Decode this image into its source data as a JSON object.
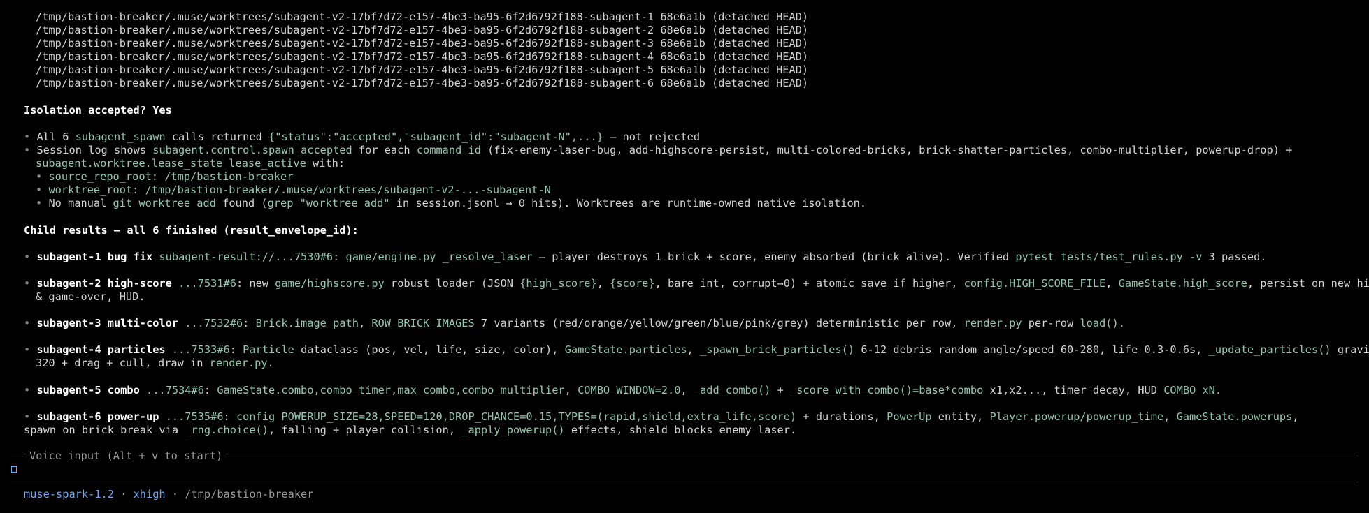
{
  "worktrees": [
    "/tmp/bastion-breaker/.muse/worktrees/subagent-v2-17bf7d72-e157-4be3-ba95-6f2d6792f188-subagent-1 68e6a1b (detached HEAD)",
    "/tmp/bastion-breaker/.muse/worktrees/subagent-v2-17bf7d72-e157-4be3-ba95-6f2d6792f188-subagent-2 68e6a1b (detached HEAD)",
    "/tmp/bastion-breaker/.muse/worktrees/subagent-v2-17bf7d72-e157-4be3-ba95-6f2d6792f188-subagent-3 68e6a1b (detached HEAD)",
    "/tmp/bastion-breaker/.muse/worktrees/subagent-v2-17bf7d72-e157-4be3-ba95-6f2d6792f188-subagent-4 68e6a1b (detached HEAD)",
    "/tmp/bastion-breaker/.muse/worktrees/subagent-v2-17bf7d72-e157-4be3-ba95-6f2d6792f188-subagent-5 68e6a1b (detached HEAD)",
    "/tmp/bastion-breaker/.muse/worktrees/subagent-v2-17bf7d72-e157-4be3-ba95-6f2d6792f188-subagent-6 68e6a1b (detached HEAD)"
  ],
  "bullet": "•",
  "isolation": {
    "heading": "Isolation accepted? Yes",
    "b1": {
      "t1": "All 6 ",
      "c1": "subagent_spawn",
      "t2": " calls returned ",
      "c2": "{\"status\":\"accepted\",\"subagent_id\":\"subagent-N\",...}",
      "t3": " — not rejected"
    },
    "b2": {
      "t1": "Session log shows ",
      "c1": "subagent.control.spawn_accepted",
      "t2": " for each ",
      "c2": "command_id",
      "t3": " (fix-enemy-laser-bug, add-highscore-persist, multi-colored-bricks, brick-shatter-particles, combo-multiplier, powerup-drop) +",
      "c3": "subagent.worktree.lease_state",
      "t4": " ",
      "c4": "lease_active",
      "t5": " with:"
    },
    "sub1": "source_repo_root: /tmp/bastion-breaker",
    "sub2": "worktree_root: /tmp/bastion-breaker/.muse/worktrees/subagent-v2-...-subagent-N",
    "sub3": {
      "t1": "No manual ",
      "c1": "git worktree add",
      "t2": " found (",
      "c2": "grep \"worktree add\"",
      "t3": " in session.jsonl → 0 hits). Worktrees are runtime-owned native isolation."
    }
  },
  "children": {
    "heading": "Child results — all 6 finished (result_envelope_id):",
    "s1": {
      "name": "subagent-1 bug fix",
      "sp": " ",
      "c1": "subagent-result://...7530#6",
      "t1": ": ",
      "c2": "game/engine.py",
      "t2": " ",
      "c3": "_resolve_laser",
      "t3": " — player destroys 1 brick + score, enemy absorbed (brick alive). Verified ",
      "c4": "pytest tests/test_rules.py -v",
      "t4": " 3 passed."
    },
    "s2": {
      "name": "subagent-2 high-score",
      "sp": " ",
      "c1": "...7531#6",
      "t1": ": new ",
      "c2": "game/highscore.py",
      "t2": " robust loader (JSON ",
      "c3": "{high_score}",
      "t3": ", ",
      "c4": "{score}",
      "t4": ", bare int, corrupt→0) + atomic save if higher, ",
      "c5": "config.HIGH_SCORE_FILE",
      "t5": ", ",
      "c6": "GameState.high_score",
      "t6": ", persist on new high",
      "line2": "& game-over, HUD."
    },
    "s3": {
      "name": "subagent-3 multi-color",
      "sp": " ",
      "c1": "...7532#6",
      "t1": ": ",
      "c2": "Brick.image_path",
      "t2": ", ",
      "c3": "ROW_BRICK_IMAGES",
      "t3": " 7 variants (red/orange/yellow/green/blue/pink/grey) deterministic per row, ",
      "c4": "render.py",
      "t4": " per-row ",
      "c5": "load().",
      "t5": ""
    },
    "s4": {
      "name": "subagent-4 particles",
      "sp": " ",
      "c1": "...7533#6",
      "t1": ": ",
      "c2": "Particle",
      "t2": " dataclass (pos, vel, life, size, color), ",
      "c3": "GameState.particles",
      "t3": ", ",
      "c4": "_spawn_brick_particles()",
      "t4": " 6-12 debris random angle/speed 60-280, life 0.3-0.6s, ",
      "c5": "_update_particles()",
      "t5": " gravity",
      "l2t1": "320 + drag + cull, draw in ",
      "l2c1": "render.py.",
      "l2t2": ""
    },
    "s5": {
      "name": "subagent-5 combo",
      "sp": " ",
      "c1": "...7534#6",
      "t1": ": ",
      "c2": "GameState.combo,combo_timer,max_combo,combo_multiplier",
      "t2": ", ",
      "c3": "COMBO_WINDOW=2.0",
      "t3": ", ",
      "c4": "_add_combo()",
      "t4": " + ",
      "c5": "_score_with_combo()=base*combo",
      "t5": " x1,x2..., timer decay, HUD ",
      "c6": "COMBO xN.",
      "t6": ""
    },
    "s6": {
      "name": "subagent-6 power-up",
      "sp": " ",
      "c1": "...7535#6",
      "t1": ": ",
      "c2": "config POWERUP_SIZE=28,SPEED=120,DROP_CHANCE=0.15,TYPES=(rapid,shield,extra_life,score)",
      "t2": " + durations, ",
      "c3": "PowerUp",
      "t3": " entity, ",
      "c4": "Player.powerup/powerup_time",
      "t4": ", ",
      "c5": "GameState.powerups",
      "t5": ",",
      "l2t1": "spawn on brick break via ",
      "l2c1": "_rng.choice()",
      "l2t2": ", falling + player collision, ",
      "l2c2": "_apply_powerup()",
      "l2t3": " effects, shield blocks enemy laser."
    }
  },
  "voice_input": {
    "label": "Voice input (Alt + v to start)"
  },
  "status_bar": {
    "model": "muse-spark-1.2",
    "sep": " · ",
    "effort": "xhigh",
    "path": "/tmp/bastion-breaker"
  }
}
